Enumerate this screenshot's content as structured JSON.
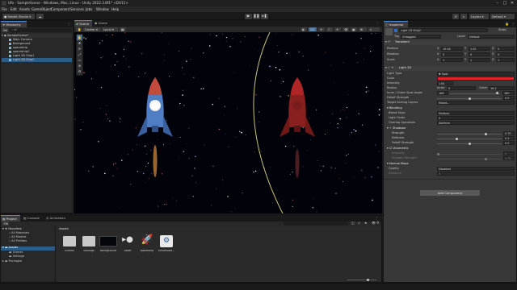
{
  "window": {
    "title": "Ufo - SampleScene - Windows, Mac, Linux - Unity 2022.3.8f1* <DX11>",
    "controls": [
      "–",
      "□",
      "✕"
    ]
  },
  "menu": [
    "File",
    "Edit",
    "Assets",
    "GameObject",
    "Component",
    "Services",
    "Jobs",
    "Window",
    "Help"
  ],
  "toolbar": {
    "account": "Rabbit Studio",
    "layers": "Layers",
    "layout": "Default"
  },
  "hierarchy": {
    "tab": "Hierarchy",
    "search_placeholder": "All",
    "items": [
      {
        "label": "SampleScene*",
        "depth": 0
      },
      {
        "label": "Main Camera",
        "depth": 1
      },
      {
        "label": "Background",
        "depth": 1
      },
      {
        "label": "spaceship",
        "depth": 1
      },
      {
        "label": "spaceship2",
        "depth": 1
      },
      {
        "label": "Light 2D Ship1",
        "depth": 1
      },
      {
        "label": "Light 2D Ship2",
        "depth": 1
      }
    ]
  },
  "scene": {
    "tabs": [
      "Scene",
      "Game"
    ],
    "center_label": "Center",
    "local_label": "Local",
    "mode_2d": "2D"
  },
  "inspector": {
    "tab": "Inspector",
    "object_name": "Light 2D Ship2",
    "static_label": "Static",
    "tag_label": "Tag",
    "tag_value": "Untagged",
    "layer_label": "Layer",
    "layer_value": "Default",
    "transform": {
      "title": "Transform",
      "rows": [
        {
          "label": "Position",
          "x": "10.04",
          "y": "1.02",
          "z": "0"
        },
        {
          "label": "Rotation",
          "x": "0",
          "y": "0",
          "z": "0"
        },
        {
          "label": "Scale",
          "x": "1",
          "y": "1",
          "z": "1"
        }
      ]
    },
    "light2d": {
      "title": "Light 2D",
      "light_type_label": "Light Type",
      "light_type_value": "Spot",
      "color_label": "Color",
      "color_hex": "#e3242b",
      "intensity_label": "Intensity",
      "intensity_value": "1.64",
      "radius_label": "Radius",
      "inner_label": "Inner",
      "inner_value": "0",
      "outer_label": "Outer",
      "outer_value": "16.2",
      "spot_angle_label": "Inner / Outer Spot Angle",
      "spot_inner": "166",
      "spot_outer": "180",
      "falloff_label": "Falloff Strength",
      "falloff_value": "0.5",
      "target_layers_label": "Target Sorting Layers",
      "target_layers_value": "Mixed...",
      "blending_title": "Blending",
      "blend_style_label": "Blend Style",
      "blend_style_value": "Multiply",
      "light_order_label": "Light Order",
      "light_order_value": "0",
      "overlap_label": "Overlap Operation",
      "overlap_value": "Additive",
      "shadows_title": "Shadows",
      "strength_label": "Strength",
      "strength_value": "0.75",
      "softness_label": "Softness",
      "softness_value": "0.3",
      "shadow_falloff_label": "Falloff Strength",
      "shadow_falloff_value": "0.5",
      "volumetric_title": "Volumetric",
      "vol_intensity_label": "Intensity",
      "vol_intensity_value": "0",
      "vol_shadow_label": "Shadow Strength",
      "vol_shadow_value": "0.75",
      "normal_maps_title": "Normal Maps",
      "quality_label": "Quality",
      "quality_value": "Disabled",
      "distance_label": "Distance",
      "distance_value": "3"
    },
    "add_component": "Add Component"
  },
  "project": {
    "tabs": [
      "Project",
      "Console",
      "Animation"
    ],
    "add_label": "+",
    "favorites_title": "Favorites",
    "favorites": [
      "All Materials",
      "All Models",
      "All Prefabs"
    ],
    "assets_title": "Assets",
    "assets_tree": [
      "Scenes",
      "Settings"
    ],
    "packages_title": "Packages",
    "breadcrumb": "Assets",
    "assets": [
      {
        "name": "Scenes",
        "kind": "folder"
      },
      {
        "name": "Settings",
        "kind": "folder"
      },
      {
        "name": "Background",
        "kind": "image"
      },
      {
        "name": "Asset",
        "kind": "sprite"
      },
      {
        "name": "spaceship",
        "kind": "ship"
      },
      {
        "name": "UniversalR...",
        "kind": "pipeline"
      }
    ]
  }
}
